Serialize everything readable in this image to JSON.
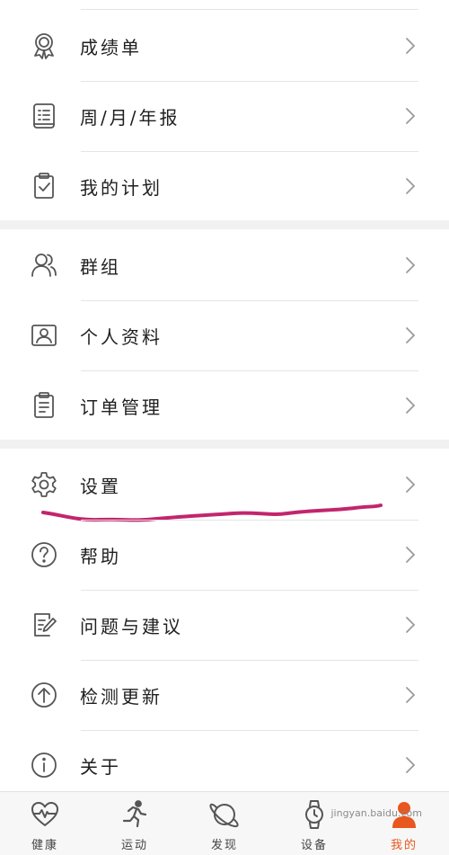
{
  "menu": {
    "group1": [
      {
        "label": "成绩单",
        "icon": "medal-icon"
      },
      {
        "label": "周/月/年报",
        "icon": "report-book-icon"
      },
      {
        "label": "我的计划",
        "icon": "clipboard-check-icon"
      }
    ],
    "group2": [
      {
        "label": "群组",
        "icon": "group-users-icon"
      },
      {
        "label": "个人资料",
        "icon": "profile-card-icon"
      },
      {
        "label": "订单管理",
        "icon": "order-list-icon"
      }
    ],
    "group3": [
      {
        "label": "设置",
        "icon": "gear-icon"
      },
      {
        "label": "帮助",
        "icon": "help-icon"
      },
      {
        "label": "问题与建议",
        "icon": "edit-note-icon"
      },
      {
        "label": "检测更新",
        "icon": "update-arrow-icon"
      },
      {
        "label": "关于",
        "icon": "info-icon"
      }
    ]
  },
  "nav": {
    "items": [
      {
        "label": "健康",
        "icon": "heart-pulse-icon"
      },
      {
        "label": "运动",
        "icon": "running-icon"
      },
      {
        "label": "发现",
        "icon": "planet-icon"
      },
      {
        "label": "设备",
        "icon": "watch-icon"
      },
      {
        "label": "我的",
        "icon": "person-icon"
      }
    ],
    "active_color": "#e8571f"
  },
  "watermark": {
    "text": "jingyan.baidu.com"
  },
  "colors": {
    "annotation_stroke": "#c2256e",
    "icon_stroke": "#555555",
    "chevron": "#9b9b9b"
  }
}
